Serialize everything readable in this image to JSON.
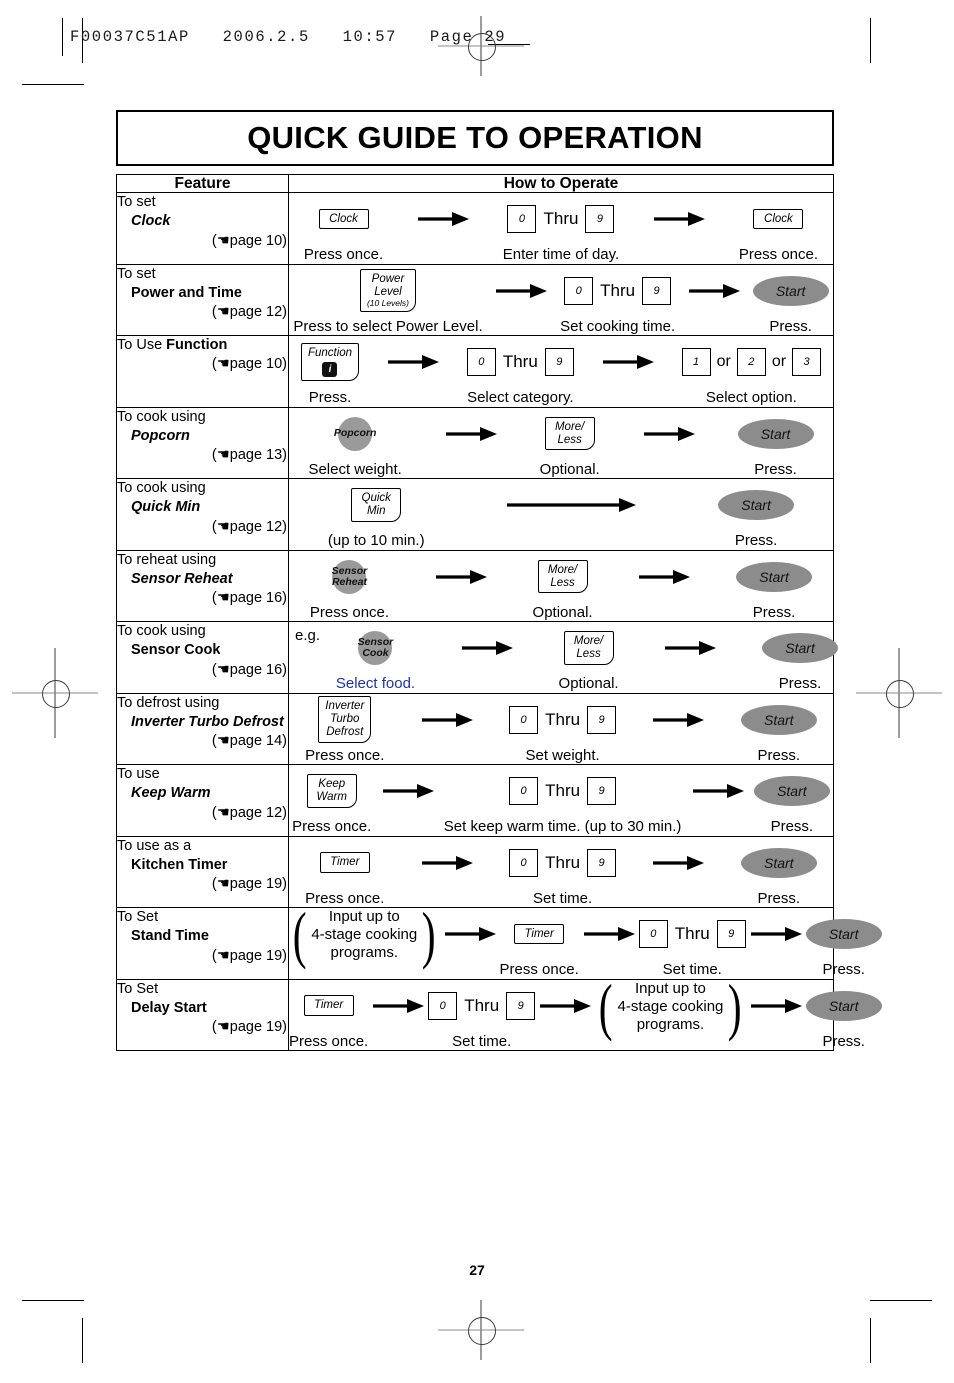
{
  "slug": {
    "job_id": "F00037C51AP",
    "date": "2006.2.5",
    "time": "10:57",
    "page_label": "Page 29"
  },
  "title": "QUICK GUIDE TO OPERATION",
  "table": {
    "headers": {
      "feature": "Feature",
      "how_to_operate": "How to Operate"
    }
  },
  "colors": {
    "key_fill": "#ffffff",
    "start_oval": "#8c8c8c",
    "sensor_pad": "#9a9a9a",
    "link_blue": "#2233aa"
  },
  "rows": [
    {
      "feature": {
        "lead": "To set",
        "name": "Clock",
        "style": "italic",
        "page_ref": "(☚page 10)"
      },
      "steps": [
        {
          "kind": "key",
          "lines": [
            "Clock"
          ],
          "caption": "Press once."
        },
        {
          "kind": "arrow"
        },
        {
          "kind": "range",
          "from": "0",
          "thru": "Thru",
          "to": "9",
          "caption": "Enter time of day."
        },
        {
          "kind": "arrow"
        },
        {
          "kind": "key",
          "lines": [
            "Clock"
          ],
          "caption": "Press once."
        }
      ]
    },
    {
      "feature": {
        "lead": "To set",
        "name": "Power and Time",
        "style": "bold",
        "page_ref": "(☚page 12)"
      },
      "steps": [
        {
          "kind": "key",
          "lines": [
            "Power",
            "Level"
          ],
          "sub": "(10 Levels)",
          "caption": "Press to select Power Level."
        },
        {
          "kind": "arrow"
        },
        {
          "kind": "range",
          "from": "0",
          "thru": "Thru",
          "to": "9",
          "caption": "Set cooking time."
        },
        {
          "kind": "arrow"
        },
        {
          "kind": "oval",
          "label": "Start",
          "caption": "Press."
        }
      ]
    },
    {
      "feature": {
        "lead": "To Use ",
        "name": "Function",
        "style": "bold-inline",
        "page_ref": "(☚page 10)"
      },
      "steps": [
        {
          "kind": "key-icon",
          "lines": [
            "Function"
          ],
          "icon": "function-icon",
          "caption": "Press."
        },
        {
          "kind": "arrow"
        },
        {
          "kind": "range",
          "from": "0",
          "thru": "Thru",
          "to": "9",
          "caption": "Select category."
        },
        {
          "kind": "arrow"
        },
        {
          "kind": "options",
          "values": [
            "1",
            "2",
            "3"
          ],
          "sep": "or",
          "caption": "Select option."
        }
      ]
    },
    {
      "feature": {
        "lead": "To cook using",
        "name": "Popcorn",
        "style": "italic",
        "page_ref": "(☚page 13)"
      },
      "steps": [
        {
          "kind": "pad",
          "lines": [
            "Popcorn"
          ],
          "caption": "Select weight."
        },
        {
          "kind": "arrow"
        },
        {
          "kind": "key",
          "lines": [
            "More/",
            "Less"
          ],
          "caption": "Optional."
        },
        {
          "kind": "arrow"
        },
        {
          "kind": "oval",
          "label": "Start",
          "caption": "Press."
        }
      ]
    },
    {
      "feature": {
        "lead": "To cook using",
        "name": "Quick Min",
        "style": "italic",
        "page_ref": "(☚page 12)"
      },
      "steps": [
        {
          "kind": "key",
          "lines": [
            "Quick",
            "Min"
          ],
          "caption": "(up to 10 min.)"
        },
        {
          "kind": "arrow",
          "long": true
        },
        {
          "kind": "oval",
          "label": "Start",
          "caption": "Press."
        }
      ]
    },
    {
      "feature": {
        "lead": "To reheat using",
        "name": "Sensor Reheat",
        "style": "italic",
        "page_ref": "(☚page 16)"
      },
      "steps": [
        {
          "kind": "pad",
          "lines": [
            "Sensor",
            "Reheat"
          ],
          "caption": "Press once."
        },
        {
          "kind": "arrow"
        },
        {
          "kind": "key",
          "lines": [
            "More/",
            "Less"
          ],
          "caption": "Optional."
        },
        {
          "kind": "arrow"
        },
        {
          "kind": "oval",
          "label": "Start",
          "caption": "Press."
        }
      ]
    },
    {
      "feature": {
        "lead": "To cook using",
        "name": "Sensor Cook",
        "style": "bold",
        "page_ref": "(☚page 16)"
      },
      "note": "e.g.",
      "steps": [
        {
          "kind": "pad",
          "lines": [
            "Sensor",
            "Cook"
          ],
          "caption": "Select food.",
          "caption_color": "blue"
        },
        {
          "kind": "arrow"
        },
        {
          "kind": "key",
          "lines": [
            "More/",
            "Less"
          ],
          "caption": "Optional."
        },
        {
          "kind": "arrow"
        },
        {
          "kind": "oval",
          "label": "Start",
          "caption": "Press."
        }
      ]
    },
    {
      "feature": {
        "lead": "To defrost using",
        "name": "Inverter Turbo Defrost",
        "style": "italic",
        "page_ref": "(☚page 14)"
      },
      "steps": [
        {
          "kind": "key",
          "lines": [
            "Inverter",
            "Turbo",
            "Defrost"
          ],
          "caption": "Press once."
        },
        {
          "kind": "arrow"
        },
        {
          "kind": "range",
          "from": "0",
          "thru": "Thru",
          "to": "9",
          "caption": "Set weight."
        },
        {
          "kind": "arrow"
        },
        {
          "kind": "oval",
          "label": "Start",
          "caption": "Press."
        }
      ]
    },
    {
      "feature": {
        "lead": "To use",
        "name": "Keep Warm",
        "style": "italic",
        "page_ref": "(☚page 12)"
      },
      "steps": [
        {
          "kind": "key",
          "lines": [
            "Keep",
            "Warm"
          ],
          "caption": "Press once."
        },
        {
          "kind": "arrow"
        },
        {
          "kind": "range",
          "from": "0",
          "thru": "Thru",
          "to": "9",
          "caption": "Set keep warm time. (up to 30 min.)"
        },
        {
          "kind": "arrow"
        },
        {
          "kind": "oval",
          "label": "Start",
          "caption": "Press."
        }
      ]
    },
    {
      "feature": {
        "lead": "To use as a",
        "name": "Kitchen Timer",
        "style": "bold",
        "page_ref": "(☚page 19)"
      },
      "steps": [
        {
          "kind": "key",
          "lines": [
            "Timer"
          ],
          "caption": "Press once."
        },
        {
          "kind": "arrow"
        },
        {
          "kind": "range",
          "from": "0",
          "thru": "Thru",
          "to": "9",
          "caption": "Set time."
        },
        {
          "kind": "arrow"
        },
        {
          "kind": "oval",
          "label": "Start",
          "caption": "Press."
        }
      ]
    },
    {
      "feature": {
        "lead": "To Set",
        "name": "Stand Time",
        "style": "bold",
        "page_ref": "(☚page 19)"
      },
      "steps": [
        {
          "kind": "brace",
          "lines": [
            "Input up to",
            "4-stage cooking",
            "programs."
          ],
          "caption": ""
        },
        {
          "kind": "arrow"
        },
        {
          "kind": "key",
          "lines": [
            "Timer"
          ],
          "caption": "Press once."
        },
        {
          "kind": "arrow"
        },
        {
          "kind": "range",
          "from": "0",
          "thru": "Thru",
          "to": "9",
          "caption": "Set time."
        },
        {
          "kind": "arrow"
        },
        {
          "kind": "oval",
          "label": "Start",
          "caption": "Press."
        }
      ]
    },
    {
      "feature": {
        "lead": "To Set",
        "name": "Delay Start",
        "style": "bold",
        "page_ref": "(☚page 19)"
      },
      "steps": [
        {
          "kind": "key",
          "lines": [
            "Timer"
          ],
          "caption": "Press once."
        },
        {
          "kind": "arrow"
        },
        {
          "kind": "range",
          "from": "0",
          "thru": "Thru",
          "to": "9",
          "caption": "Set time."
        },
        {
          "kind": "arrow"
        },
        {
          "kind": "brace",
          "lines": [
            "Input up to",
            "4-stage cooking",
            "programs."
          ],
          "caption": ""
        },
        {
          "kind": "arrow"
        },
        {
          "kind": "oval",
          "label": "Start",
          "caption": "Press."
        }
      ]
    }
  ],
  "folio": "27"
}
